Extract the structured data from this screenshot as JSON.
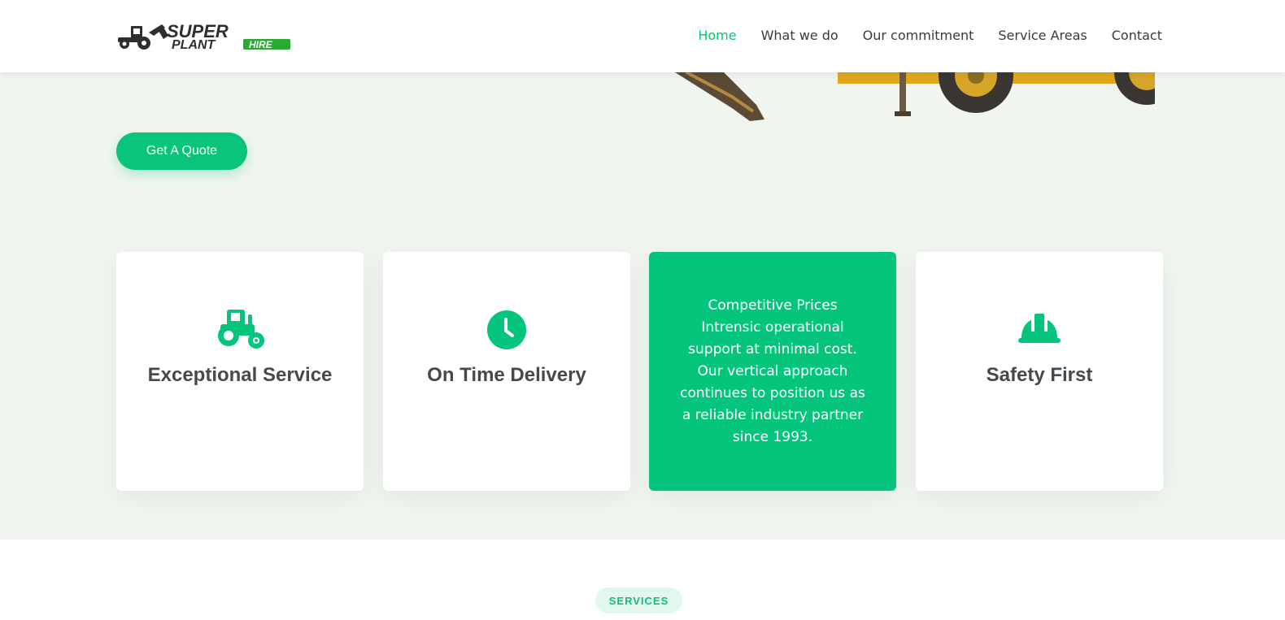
{
  "header": {
    "logo": {
      "word1": "SUPER",
      "word2": "PLANT",
      "word3": "HIRE"
    },
    "nav": [
      {
        "label": "Home",
        "active": true
      },
      {
        "label": "What we do",
        "active": false
      },
      {
        "label": "Our commitment",
        "active": false
      },
      {
        "label": "Service Areas",
        "active": false
      },
      {
        "label": "Contact",
        "active": false
      }
    ]
  },
  "hero": {
    "cta_label": "Get A Quote"
  },
  "features": [
    {
      "icon": "tractor-icon",
      "title": "Exceptional Service"
    },
    {
      "icon": "clock-icon",
      "title": "On Time Delivery"
    },
    {
      "description": "Competitive Prices Intrensic operational support at minimal cost. Our vertical approach continues to position us as a reliable industry partner since 1993."
    },
    {
      "icon": "hard-hat-icon",
      "title": "Safety First"
    }
  ],
  "services": {
    "badge": "SERVICES"
  },
  "colors": {
    "accent": "#05c47b",
    "hero_bg": "#f0f5f0",
    "text_dark": "#444a4d"
  }
}
